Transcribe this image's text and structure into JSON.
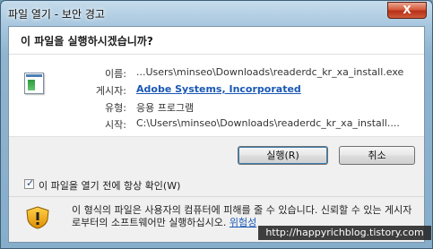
{
  "window": {
    "title": "파일 열기 - 보안 경고",
    "close_label": "X"
  },
  "question": "이 파일을 실행하시겠습니까?",
  "file": {
    "icon": "installer-file-icon",
    "rows": [
      {
        "label": "이름:",
        "value": "...Users\\minseo\\Downloads\\readerdc_kr_xa_install.exe"
      },
      {
        "label": "게시자:",
        "value": "Adobe Systems, Incorporated"
      },
      {
        "label": "유형:",
        "value": "응용 프로그램"
      },
      {
        "label": "시작:",
        "value": "C:\\Users\\minseo\\Downloads\\readerdc_kr_xa_install...."
      }
    ]
  },
  "buttons": {
    "run": "실행(R)",
    "cancel": "취소"
  },
  "checkbox": {
    "label": "이 파일을 열기 전에 항상 확인(W)",
    "checked": true
  },
  "warning": {
    "icon": "security-shield-icon",
    "text": "이 형식의 파일은 사용자의 컴퓨터에 피해를 줄 수 있습니다. 신뢰할 수 있는 게시자로부터의 소프트웨어만 실행하십시오.",
    "link": "위험성"
  },
  "watermark": "http://happyrichblog.tistory.com"
}
